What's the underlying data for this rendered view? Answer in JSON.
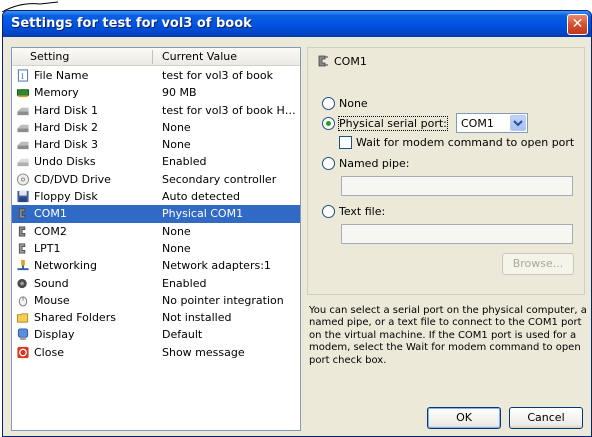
{
  "window": {
    "title": "Settings for test for vol3 of book",
    "close_glyph": "✕"
  },
  "list": {
    "headers": {
      "setting": "Setting",
      "value": "Current Value"
    },
    "rows": [
      {
        "name": "File Name",
        "value": "test for vol3 of book",
        "icon": "file-icon"
      },
      {
        "name": "Memory",
        "value": "90 MB",
        "icon": "memory-icon"
      },
      {
        "name": "Hard Disk 1",
        "value": "test for vol3 of book Ha...",
        "icon": "hard-disk-icon"
      },
      {
        "name": "Hard Disk 2",
        "value": "None",
        "icon": "hard-disk-icon"
      },
      {
        "name": "Hard Disk 3",
        "value": "None",
        "icon": "hard-disk-icon"
      },
      {
        "name": "Undo Disks",
        "value": "Enabled",
        "icon": "undo-disk-icon"
      },
      {
        "name": "CD/DVD Drive",
        "value": "Secondary controller",
        "icon": "cd-dvd-icon"
      },
      {
        "name": "Floppy Disk",
        "value": "Auto detected",
        "icon": "floppy-icon"
      },
      {
        "name": "COM1",
        "value": "Physical COM1",
        "icon": "serial-port-icon",
        "selected": true
      },
      {
        "name": "COM2",
        "value": "None",
        "icon": "serial-port-icon"
      },
      {
        "name": "LPT1",
        "value": "None",
        "icon": "parallel-port-icon"
      },
      {
        "name": "Networking",
        "value": "Network adapters:1",
        "icon": "network-icon"
      },
      {
        "name": "Sound",
        "value": "Enabled",
        "icon": "sound-icon"
      },
      {
        "name": "Mouse",
        "value": "No pointer integration",
        "icon": "mouse-icon"
      },
      {
        "name": "Shared Folders",
        "value": "Not installed",
        "icon": "folder-icon"
      },
      {
        "name": "Display",
        "value": "Default",
        "icon": "display-icon"
      },
      {
        "name": "Close",
        "value": "Show message",
        "icon": "close-action-icon"
      }
    ]
  },
  "config": {
    "title": "COM1",
    "none_label": "None",
    "physical_label": "Physical serial port:",
    "physical_selected": "COM1",
    "wait_label": "Wait for modem command to open port",
    "named_pipe_label": "Named pipe:",
    "text_file_label": "Text file:",
    "browse_label": "Browse...",
    "selected_option": "physical"
  },
  "help_text": "You can select a serial port on the physical computer, a named pipe, or a text file to connect to the COM1 port on the virtual machine. If the COM1 port is used for a modem, select the Wait for modem command to open port check box.",
  "buttons": {
    "ok": "OK",
    "cancel": "Cancel"
  },
  "colors": {
    "title_bar": "#0054e3",
    "selection": "#316ac5",
    "dialog_bg": "#ece9d8"
  }
}
